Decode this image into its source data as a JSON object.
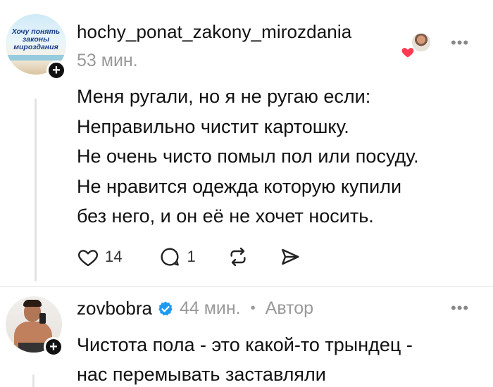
{
  "post1": {
    "avatar_caption": [
      "Хочу понять",
      "законы",
      "мироздания"
    ],
    "username": "hochy_ponat_zakony_mirozdania",
    "time": "53 мин.",
    "lines": [
      "Меня ругали, но я не ругаю если:",
      "Неправильно чистит картошку.",
      "Не очень чисто помыл пол или посуду.",
      "Не нравится одежда которую купили",
      "без него, и он её не хочет носить."
    ],
    "likes": "14",
    "replies": "1",
    "more_icon": "more-horizontal-icon",
    "colors": {
      "heart": "#ff3b52",
      "muted": "#999999"
    }
  },
  "post2": {
    "username": "zovbobra",
    "time": "44 мин.",
    "separator": "•",
    "author_label": "Автор",
    "lines": [
      "Чистота пола - это какой-то трындец -",
      "нас перемывать заставляли"
    ],
    "colors": {
      "verified": "#1d9bf0"
    }
  }
}
